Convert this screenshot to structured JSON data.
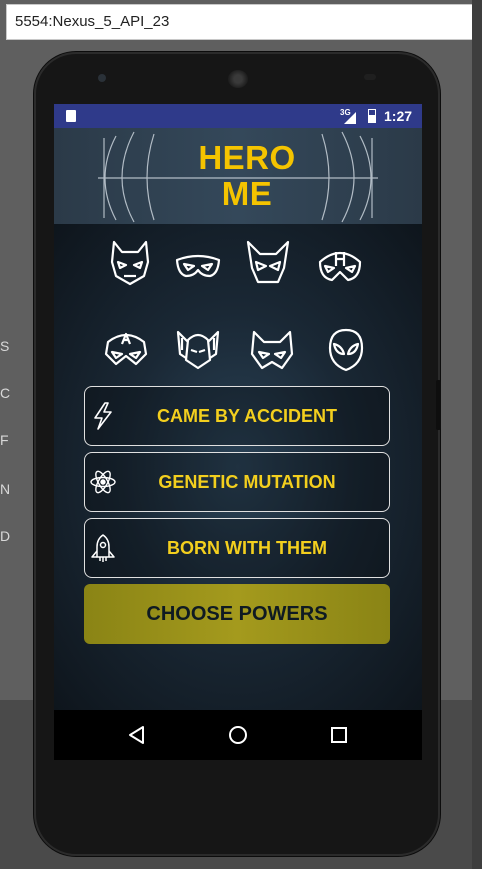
{
  "window": {
    "title": "5554:Nexus_5_API_23"
  },
  "background": {
    "letters": [
      "S",
      "C",
      "F",
      "N",
      "D"
    ]
  },
  "status_bar": {
    "network": "3G",
    "time": "1:27"
  },
  "app": {
    "title_line1": "HERO",
    "title_line2": "ME",
    "masks_row1": [
      "batman-icon",
      "robin-icon",
      "wolverine-icon",
      "hawkeye-icon"
    ],
    "masks_row2": [
      "captain-america-icon",
      "thor-icon",
      "catwoman-icon",
      "spiderman-icon"
    ],
    "options": [
      {
        "label": "CAME BY ACCIDENT",
        "icon": "lightning-icon"
      },
      {
        "label": "GENETIC MUTATION",
        "icon": "atom-icon"
      },
      {
        "label": "BORN WITH THEM",
        "icon": "rocket-icon"
      }
    ],
    "choose_button": "CHOOSE POWERS"
  },
  "nav_bar": {
    "buttons": [
      "back-icon",
      "home-icon",
      "recents-icon"
    ]
  },
  "colors": {
    "accent": "#f5c400",
    "status_bar": "#2f3a8a",
    "button": "#a49a1d"
  }
}
